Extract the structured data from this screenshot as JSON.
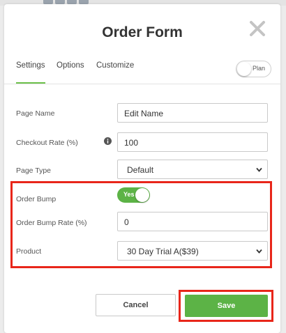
{
  "modal": {
    "title": "Order Form"
  },
  "tabs": [
    {
      "label": "Settings",
      "active": true
    },
    {
      "label": "Options",
      "active": false
    },
    {
      "label": "Customize",
      "active": false
    }
  ],
  "plan_toggle": {
    "label": "Plan",
    "on": false
  },
  "fields": {
    "page_name": {
      "label": "Page Name",
      "value": "Edit Name"
    },
    "checkout_rate": {
      "label": "Checkout Rate (%)",
      "value": "100"
    },
    "page_type": {
      "label": "Page Type",
      "value": "Default"
    },
    "order_bump": {
      "label": "Order Bump",
      "toggle_label": "Yes",
      "on": true
    },
    "order_bump_rate": {
      "label": "Order Bump Rate (%)",
      "value": "0"
    },
    "product": {
      "label": "Product",
      "value": "30 Day Trial A($39)"
    }
  },
  "buttons": {
    "cancel": "Cancel",
    "save": "Save"
  },
  "colors": {
    "accent_green": "#5cb346",
    "highlight_red": "#e8261a"
  },
  "icons": {
    "close": "close-icon",
    "info": "info-icon",
    "dropdown": "chevron-down-icon"
  }
}
